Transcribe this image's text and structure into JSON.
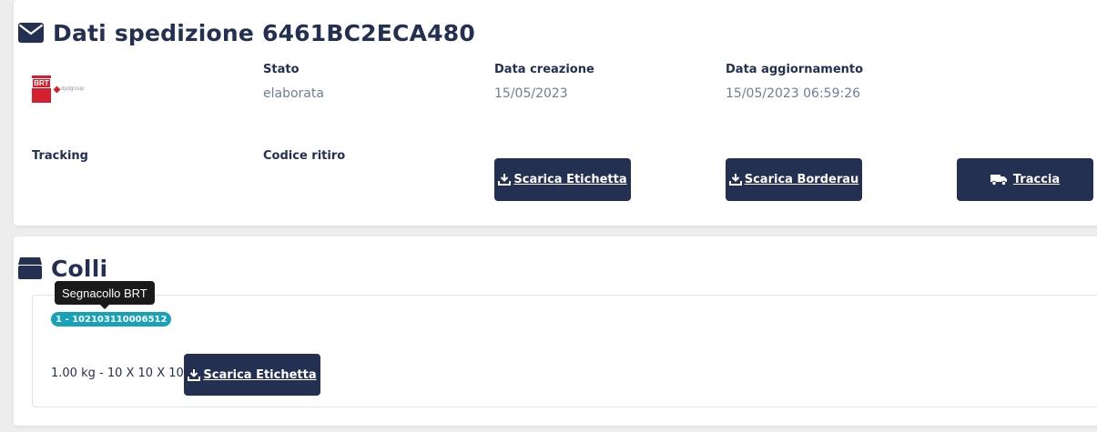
{
  "shipment": {
    "title": "Dati spedizione 6461BC2ECA480",
    "carrier_logo": {
      "brand": "BRT",
      "tagline": "dpdgroup"
    },
    "fields": {
      "stato_label": "Stato",
      "stato_value": "elaborata",
      "data_creazione_label": "Data creazione",
      "data_creazione_value": "15/05/2023",
      "data_aggiornamento_label": "Data aggiornamento",
      "data_aggiornamento_value": "15/05/2023 06:59:26",
      "tracking_label": "Tracking",
      "codice_ritiro_label": "Codice ritiro"
    },
    "buttons": {
      "scarica_etichetta": "Scarica Etichetta",
      "scarica_borderau": "Scarica Borderau",
      "traccia": "Traccia"
    }
  },
  "parcels": {
    "title": "Colli",
    "tooltip": "Segnacollo BRT",
    "items": [
      {
        "badge": "1 - 102103110006512",
        "description": "1.00 kg - 10 X 10 X 10",
        "download_label": "Scarica Etichetta"
      }
    ]
  },
  "icons": {
    "shipment_title": "envelope-icon",
    "parcels_title": "box-icon",
    "download": "download-icon",
    "traccia": "truck-icon"
  },
  "colors": {
    "primary": "#243052",
    "muted_value": "#6e7f97",
    "badge": "#17a2b8",
    "brand_red": "#d4202e"
  }
}
